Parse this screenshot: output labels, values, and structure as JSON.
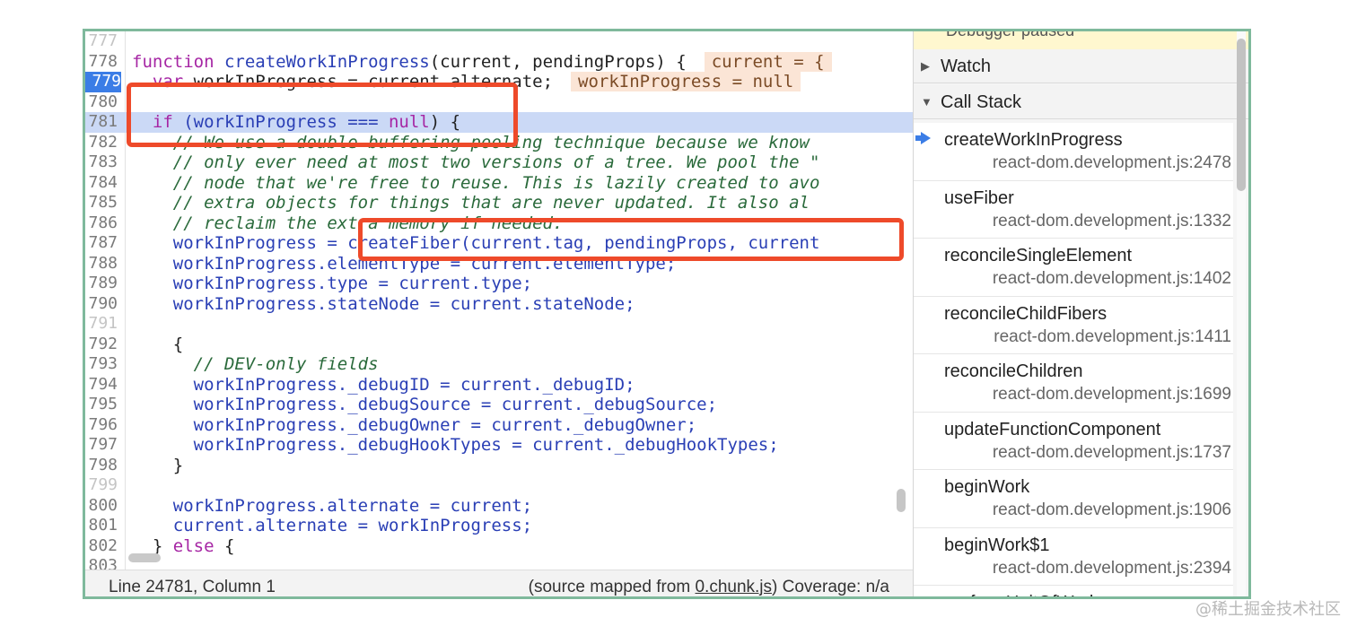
{
  "editor": {
    "lines": [
      {
        "num": "777",
        "dim": true,
        "segments": []
      },
      {
        "num": "778",
        "segments": [
          {
            "t": "function ",
            "c": "kw"
          },
          {
            "t": "createWorkInProgress",
            "c": "fn"
          },
          {
            "t": "(current, pendingProps) {",
            "c": "pl"
          },
          {
            "t": "current = {",
            "c": "inl"
          }
        ]
      },
      {
        "num": "779",
        "current": true,
        "segments": [
          {
            "t": "  var ",
            "c": "kw"
          },
          {
            "t": "workInProgress = current.alternate;",
            "c": "pl"
          },
          {
            "t": "workInProgress = null",
            "c": "inl"
          }
        ]
      },
      {
        "num": "780",
        "segments": []
      },
      {
        "num": "781",
        "highlight": true,
        "segments": [
          {
            "t": "  if ",
            "c": "kw"
          },
          {
            "t": "(workInProgress === ",
            "c": "fn"
          },
          {
            "t": "null",
            "c": "kw"
          },
          {
            "t": ") {",
            "c": "pl"
          }
        ]
      },
      {
        "num": "782",
        "segments": [
          {
            "t": "    // We use a double buffering pooling technique because we know",
            "c": "cm"
          }
        ]
      },
      {
        "num": "783",
        "segments": [
          {
            "t": "    // only ever need at most two versions of a tree. We pool the \"",
            "c": "cm"
          }
        ]
      },
      {
        "num": "784",
        "segments": [
          {
            "t": "    // node that we're free to reuse. This is lazily created to avo",
            "c": "cm"
          }
        ]
      },
      {
        "num": "785",
        "segments": [
          {
            "t": "    // extra objects for things that are never updated. It also al",
            "c": "cm"
          }
        ]
      },
      {
        "num": "786",
        "segments": [
          {
            "t": "    // reclaim the extra memory if needed.",
            "c": "cm"
          }
        ]
      },
      {
        "num": "787",
        "segments": [
          {
            "t": "    workInProgress = ",
            "c": "fn"
          },
          {
            "t": "createFiber",
            "c": "fn"
          },
          {
            "t": "(current.tag, pendingProps, current",
            "c": "fn"
          }
        ]
      },
      {
        "num": "788",
        "segments": [
          {
            "t": "    workInProgress.elementType = current.elementType;",
            "c": "fn"
          }
        ]
      },
      {
        "num": "789",
        "segments": [
          {
            "t": "    workInProgress.type = current.type;",
            "c": "fn"
          }
        ]
      },
      {
        "num": "790",
        "segments": [
          {
            "t": "    workInProgress.stateNode = current.stateNode;",
            "c": "fn"
          }
        ]
      },
      {
        "num": "791",
        "dim": true,
        "segments": []
      },
      {
        "num": "792",
        "segments": [
          {
            "t": "    {",
            "c": "pl"
          }
        ]
      },
      {
        "num": "793",
        "segments": [
          {
            "t": "      // DEV-only fields",
            "c": "cm"
          }
        ]
      },
      {
        "num": "794",
        "segments": [
          {
            "t": "      workInProgress._debugID = current._debugID;",
            "c": "fn"
          }
        ]
      },
      {
        "num": "795",
        "segments": [
          {
            "t": "      workInProgress._debugSource = current._debugSource;",
            "c": "fn"
          }
        ]
      },
      {
        "num": "796",
        "segments": [
          {
            "t": "      workInProgress._debugOwner = current._debugOwner;",
            "c": "fn"
          }
        ]
      },
      {
        "num": "797",
        "segments": [
          {
            "t": "      workInProgress._debugHookTypes = current._debugHookTypes;",
            "c": "fn"
          }
        ]
      },
      {
        "num": "798",
        "segments": [
          {
            "t": "    }",
            "c": "pl"
          }
        ]
      },
      {
        "num": "799",
        "dim": true,
        "segments": []
      },
      {
        "num": "800",
        "segments": [
          {
            "t": "    workInProgress.alternate = current;",
            "c": "fn"
          }
        ]
      },
      {
        "num": "801",
        "segments": [
          {
            "t": "    current.alternate = workInProgress;",
            "c": "fn"
          }
        ]
      },
      {
        "num": "802",
        "segments": [
          {
            "t": "  } ",
            "c": "pl"
          },
          {
            "t": "else",
            "c": "kw"
          },
          {
            "t": " {",
            "c": "pl"
          }
        ]
      },
      {
        "num": "803",
        "segments": []
      }
    ]
  },
  "status": {
    "position": "Line 24781, Column 1",
    "source_prefix": "(source mapped from ",
    "source_file": "0.chunk.js",
    "source_suffix": ")",
    "coverage": "Coverage: n/a"
  },
  "panel": {
    "paused": "Debugger paused",
    "watch": "Watch",
    "call_stack": "Call Stack",
    "frames": [
      {
        "name": "createWorkInProgress",
        "location": "react-dom.development.js:2478",
        "active": true
      },
      {
        "name": "useFiber",
        "location": "react-dom.development.js:1332"
      },
      {
        "name": "reconcileSingleElement",
        "location": "react-dom.development.js:1402"
      },
      {
        "name": "reconcileChildFibers",
        "location": "react-dom.development.js:1411"
      },
      {
        "name": "reconcileChildren",
        "location": "react-dom.development.js:1699"
      },
      {
        "name": "updateFunctionComponent",
        "location": "react-dom.development.js:1737"
      },
      {
        "name": "beginWork",
        "location": "react-dom.development.js:1906"
      },
      {
        "name": "beginWork$1",
        "location": "react-dom.development.js:2394"
      },
      {
        "name": "performUnitOfWork",
        "location": ""
      }
    ]
  },
  "watermark": "@稀土掘金技术社区"
}
